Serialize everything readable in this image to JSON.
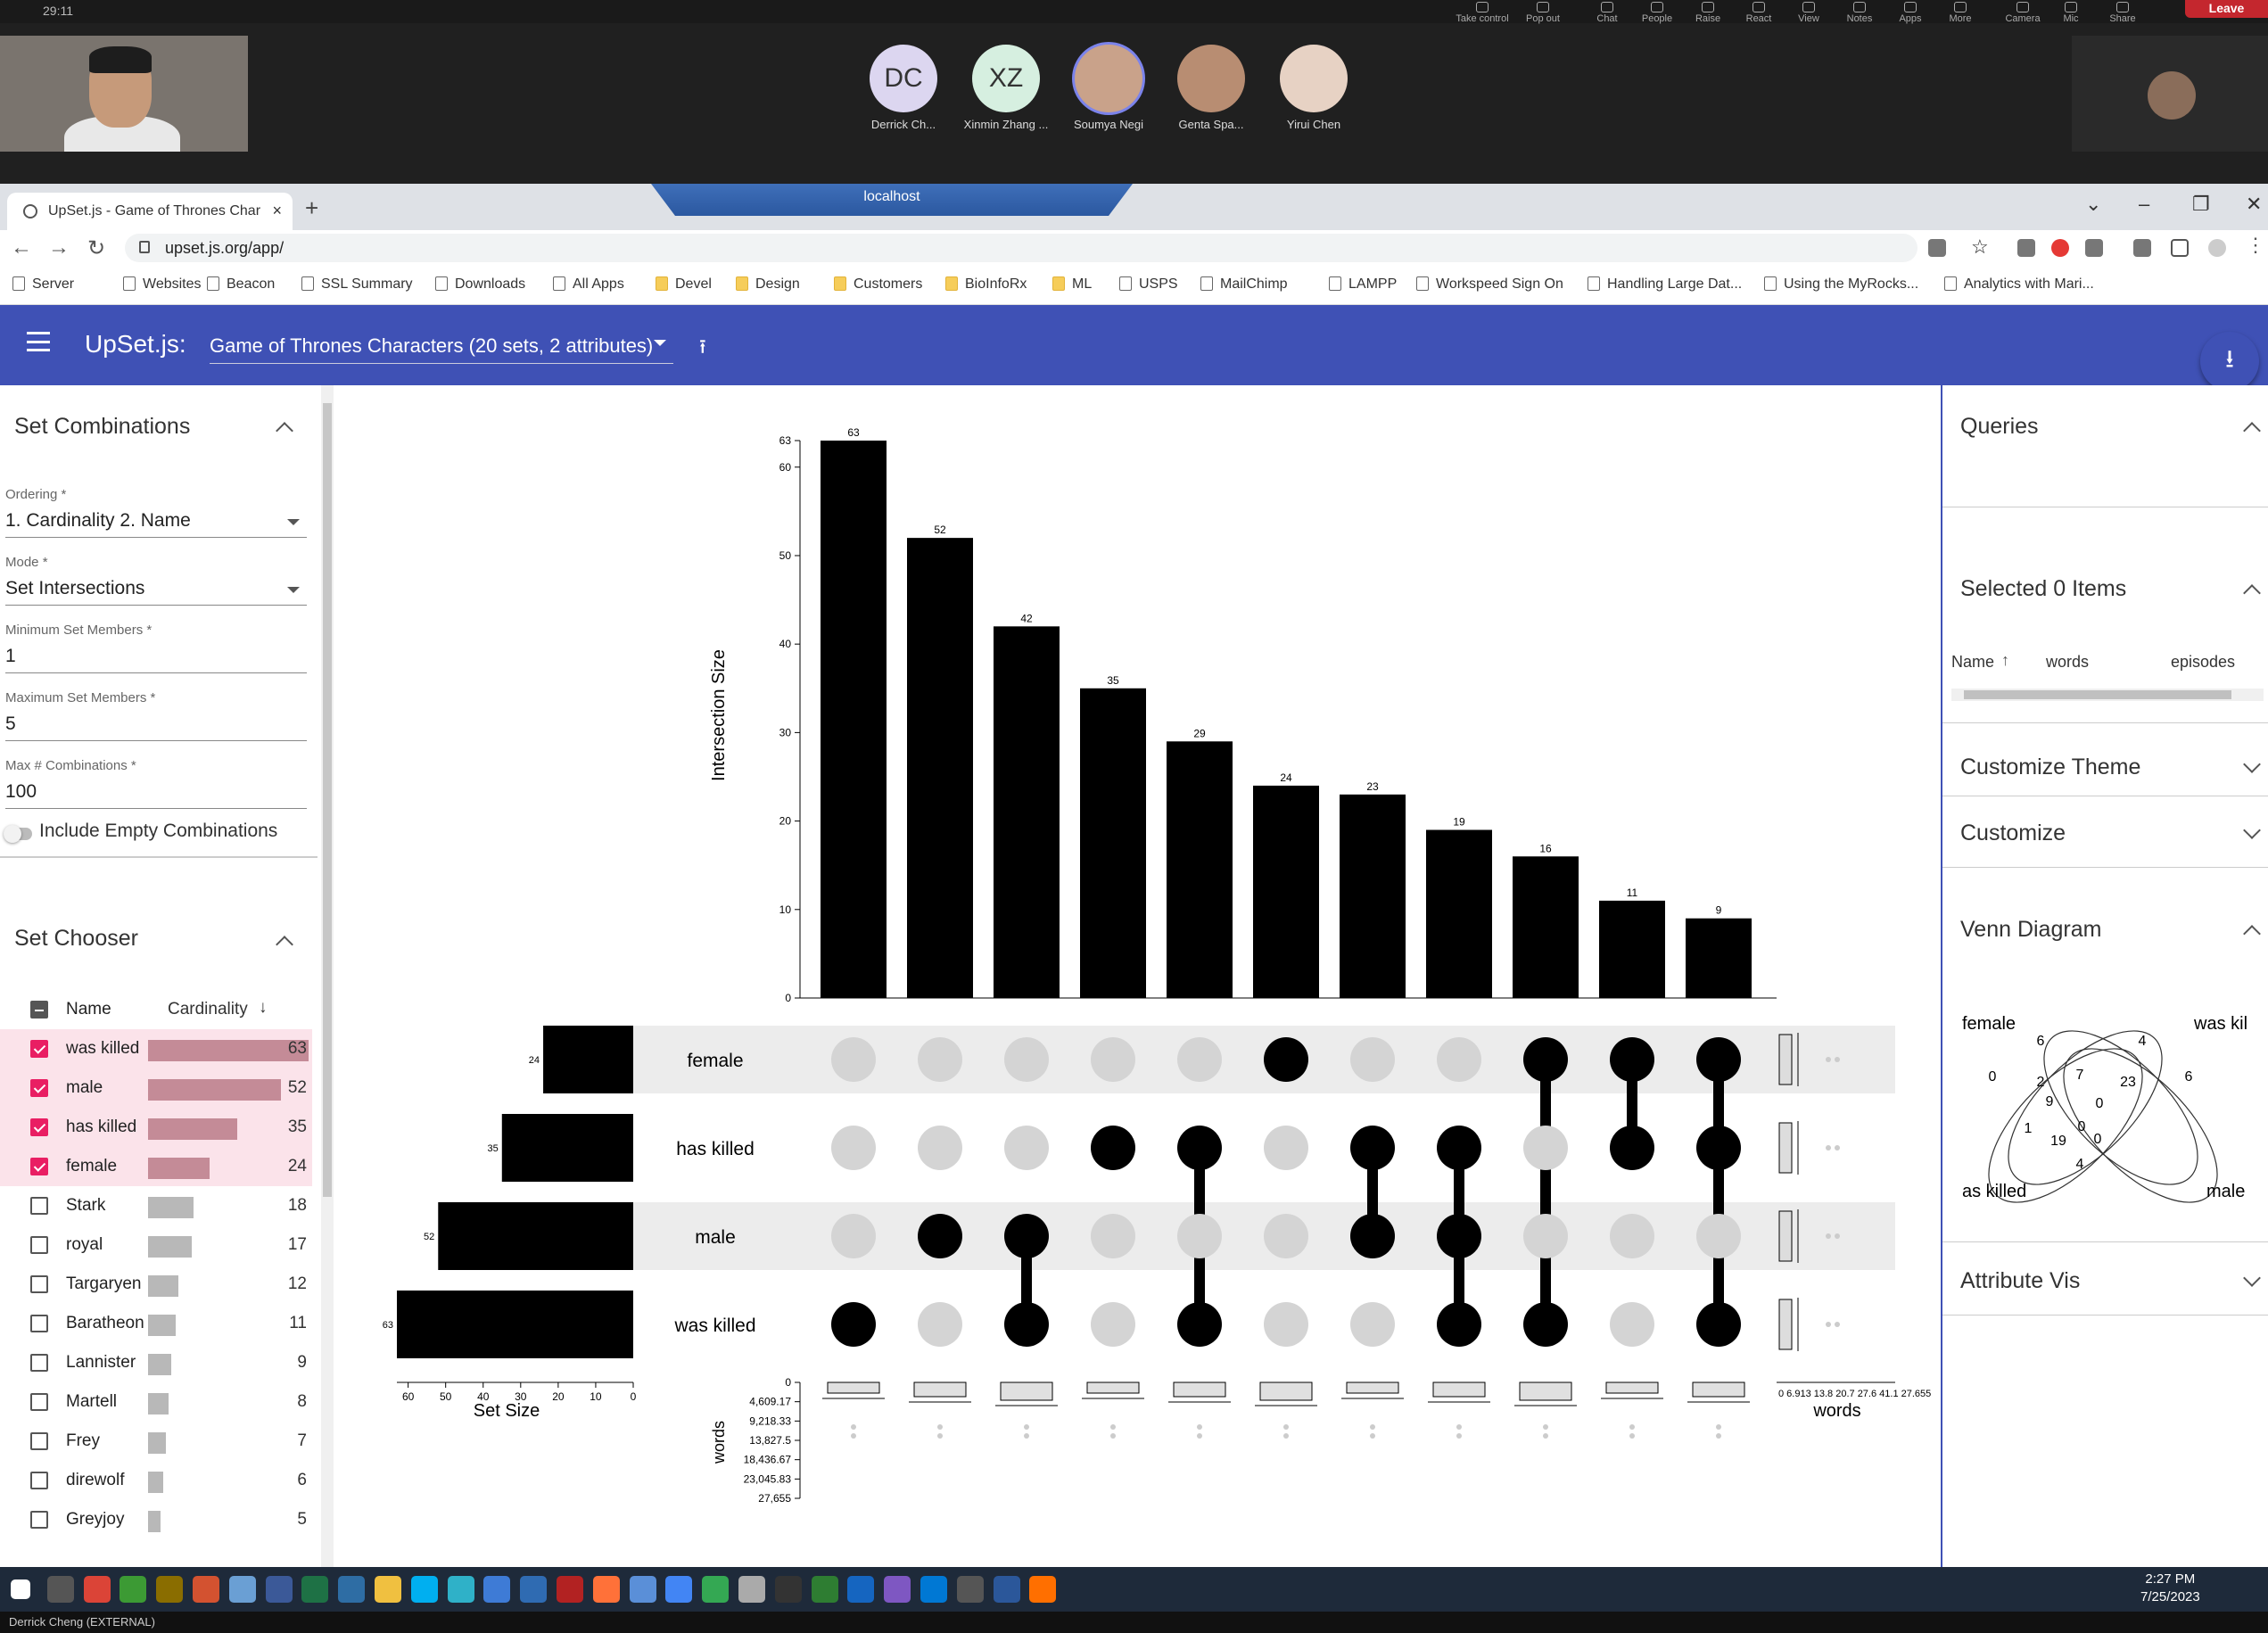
{
  "zoom": {
    "time": "29:11",
    "controls": [
      "Take control",
      "Pop out",
      "Chat",
      "People",
      "Raise",
      "React",
      "View",
      "Notes",
      "Apps",
      "More",
      "Camera",
      "Mic",
      "Share"
    ],
    "leave": "Leave",
    "participants": [
      {
        "initials": "DC",
        "name": "Derrick Ch...",
        "color": "#dcd6f0"
      },
      {
        "initials": "XZ",
        "name": "Xinmin Zhang ...",
        "color": "#d6efe0"
      },
      {
        "initials": "",
        "name": "Soumya Negi",
        "color": "#c9a28a"
      },
      {
        "initials": "",
        "name": "Genta Spa...",
        "color": "#b88d72"
      },
      {
        "initials": "",
        "name": "Yirui Chen",
        "color": "#e7d2c4"
      }
    ],
    "footer": "Derrick Cheng (EXTERNAL)"
  },
  "browser": {
    "tab_title": "UpSet.js - Game of Thrones Char",
    "rdp_title": "localhost",
    "url": "upset.js.org/app/",
    "bookmarks": [
      "Server",
      "Websites",
      "Beacon",
      "SSL Summary",
      "Downloads",
      "All Apps",
      "Devel",
      "Design",
      "Customers",
      "BioInfoRx",
      "ML",
      "USPS",
      "MailChimp",
      "LAMPP",
      "Workspeed Sign On",
      "Handling Large Dat...",
      "Using the MyRocks...",
      "Analytics with Mari..."
    ]
  },
  "app": {
    "brand": "UpSet.js:",
    "dataset": "Game of Thrones Characters (20 sets, 2 attributes)"
  },
  "left": {
    "set_combinations": "Set Combinations",
    "ordering_label": "Ordering *",
    "ordering_value": "1. Cardinality 2. Name",
    "mode_label": "Mode *",
    "mode_value": "Set Intersections",
    "min_label": "Minimum Set Members *",
    "min_value": "1",
    "max_label": "Maximum Set Members *",
    "max_value": "5",
    "maxc_label": "Max # Combinations *",
    "maxc_value": "100",
    "include_empty": "Include Empty Combinations",
    "set_chooser": "Set Chooser",
    "col_name": "Name",
    "col_card": "Cardinality",
    "sets": [
      {
        "name": "was killed",
        "count": "63",
        "selected": true,
        "v": 63
      },
      {
        "name": "male",
        "count": "52",
        "selected": true,
        "v": 52
      },
      {
        "name": "has killed",
        "count": "35",
        "selected": true,
        "v": 35
      },
      {
        "name": "female",
        "count": "24",
        "selected": true,
        "v": 24
      },
      {
        "name": "Stark",
        "count": "18",
        "selected": false,
        "v": 18
      },
      {
        "name": "royal",
        "count": "17",
        "selected": false,
        "v": 17
      },
      {
        "name": "Targaryen",
        "count": "12",
        "selected": false,
        "v": 12
      },
      {
        "name": "Baratheon",
        "count": "11",
        "selected": false,
        "v": 11
      },
      {
        "name": "Lannister",
        "count": "9",
        "selected": false,
        "v": 9
      },
      {
        "name": "Martell",
        "count": "8",
        "selected": false,
        "v": 8
      },
      {
        "name": "Frey",
        "count": "7",
        "selected": false,
        "v": 7
      },
      {
        "name": "direwolf",
        "count": "6",
        "selected": false,
        "v": 6
      },
      {
        "name": "Greyjoy",
        "count": "5",
        "selected": false,
        "v": 5
      }
    ]
  },
  "right": {
    "queries": "Queries",
    "selected": "Selected 0 Items",
    "cols": [
      "Name",
      "words",
      "episodes"
    ],
    "customize_theme": "Customize Theme",
    "customize": "Customize",
    "venn": "Venn Diagram",
    "venn_labels": {
      "female": "female",
      "wk": "was kil",
      "hk": "as killed",
      "male": "male"
    },
    "venn_counts": [
      "6",
      "4",
      "0",
      "7",
      "2",
      "23",
      "6",
      "9",
      "0",
      "1",
      "0",
      "19",
      "0",
      "4"
    ],
    "attribute_vis": "Attribute Vis"
  },
  "chart_data": {
    "type": "bar",
    "title": "",
    "ylabel": "Intersection Size",
    "ylim": [
      0,
      63
    ],
    "yticks": [
      "0",
      "10",
      "20",
      "30",
      "40",
      "50",
      "60",
      "63"
    ],
    "values": [
      63,
      52,
      42,
      35,
      29,
      24,
      23,
      19,
      16,
      11,
      9
    ],
    "value_labels": [
      "63",
      "52",
      "42",
      "35",
      "29",
      "24",
      "23",
      "19",
      "16",
      "11",
      "9"
    ],
    "sets": [
      "female",
      "has killed",
      "male",
      "was killed"
    ],
    "set_sizes": [
      24,
      35,
      52,
      63
    ],
    "set_size_labels": [
      "24",
      "35",
      "52",
      "63"
    ],
    "set_size_xlabel": "Set Size",
    "set_size_ticks": [
      "60",
      "50",
      "40",
      "30",
      "20",
      "10",
      "0"
    ],
    "memberships": [
      [
        "was killed"
      ],
      [
        "male"
      ],
      [
        "male",
        "was killed"
      ],
      [
        "has killed"
      ],
      [
        "has killed",
        "was killed"
      ],
      [
        "female"
      ],
      [
        "has killed",
        "male"
      ],
      [
        "has killed",
        "male",
        "was killed"
      ],
      [
        "female",
        "was killed"
      ],
      [
        "female",
        "has killed"
      ],
      [
        "female",
        "has killed",
        "was killed"
      ]
    ],
    "attr_label": "words",
    "attr_ticks": [
      "0",
      "4,609.17",
      "9,218.33",
      "13,827.5",
      "18,436.67",
      "23,045.83",
      "27,655"
    ],
    "attr_xlabel": "words",
    "attr_xticks": "0 6.913 13.8 20.7 27.6 41.1 27.655"
  },
  "taskbar": {
    "time": "2:27 PM",
    "date": "7/25/2023"
  }
}
